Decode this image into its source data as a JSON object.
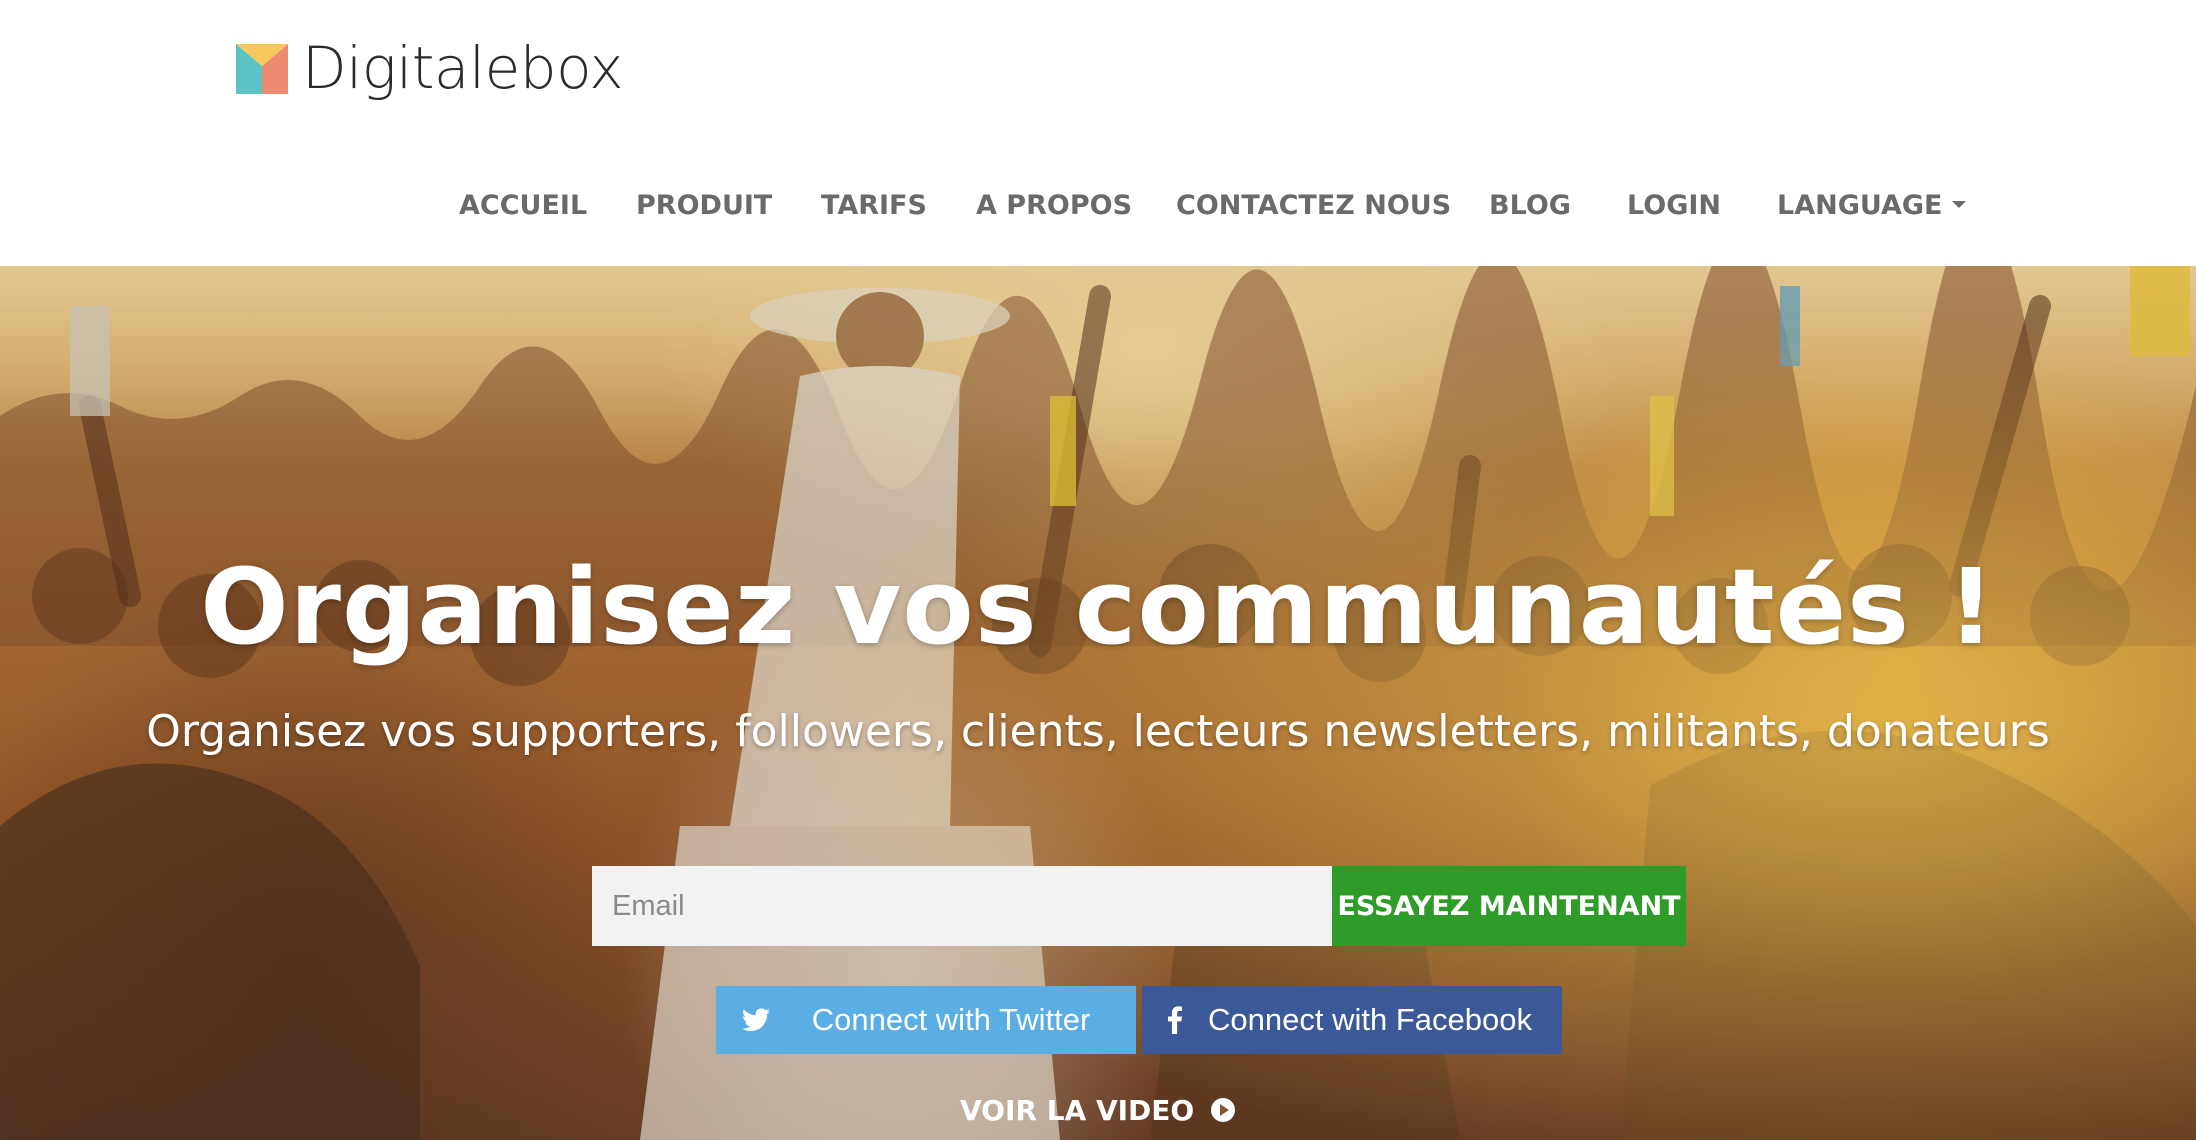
{
  "brand": {
    "name": "Digitalebox",
    "colors": {
      "logo_teal": "#5bc3c5",
      "logo_coral": "#ee8a6f",
      "logo_yellow": "#f6c95e",
      "accent_green": "#2f9c2a",
      "twitter_blue": "#5aaee3",
      "facebook_blue": "#3b5998"
    }
  },
  "nav": {
    "items": [
      {
        "label": "ACCUEIL"
      },
      {
        "label": "PRODUIT"
      },
      {
        "label": "TARIFS"
      },
      {
        "label": "A PROPOS"
      },
      {
        "label": "CONTACTEZ NOUS"
      },
      {
        "label": "BLOG"
      },
      {
        "label": "LOGIN"
      },
      {
        "label": "LANGUAGE"
      }
    ],
    "language_icon": "caret-down-icon"
  },
  "hero": {
    "title": "Organisez vos communautés !",
    "subtitle": "Organisez vos supporters, followers, clients, lecteurs newsletters, militants, donateurs",
    "email_placeholder": "Email",
    "email_value": "",
    "cta_label": "ESSAYEZ MAINTENANT",
    "twitter_label": "Connect with Twitter",
    "twitter_icon": "twitter-icon",
    "facebook_label": "Connect with Facebook",
    "facebook_icon": "facebook-icon",
    "video_label": "VOIR LA VIDEO",
    "video_icon": "play-circle-icon"
  }
}
